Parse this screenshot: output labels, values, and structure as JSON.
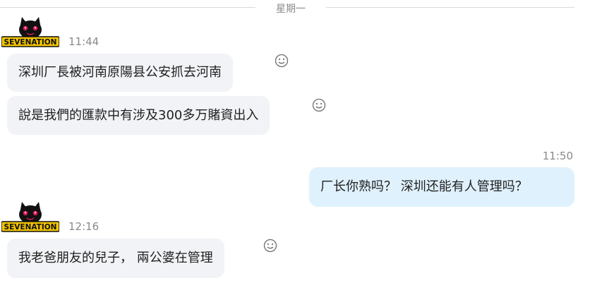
{
  "divider": {
    "day": "星期一"
  },
  "avatar": {
    "brand_text": "SEVENATION",
    "brand_color": "#f2c400",
    "cat_color": "#111111",
    "eye_color": "#e0195c"
  },
  "groups": [
    {
      "time": "11:44",
      "messages": [
        {
          "text": "深圳厂長被河南原陽县公安抓去河南"
        },
        {
          "text": "說是我們的匯款中有涉及300多万賭資出入"
        }
      ]
    },
    {
      "time": "12:16",
      "messages": [
        {
          "text": "我老爸朋友的兒子， 兩公婆在管理"
        }
      ]
    }
  ],
  "outgoing": {
    "time": "11:50",
    "text": "厂长你熟吗？ 深圳还能有人管理吗？",
    "bubble_color": "#dff1fd"
  },
  "icons": {
    "reaction": "smiley-icon"
  }
}
